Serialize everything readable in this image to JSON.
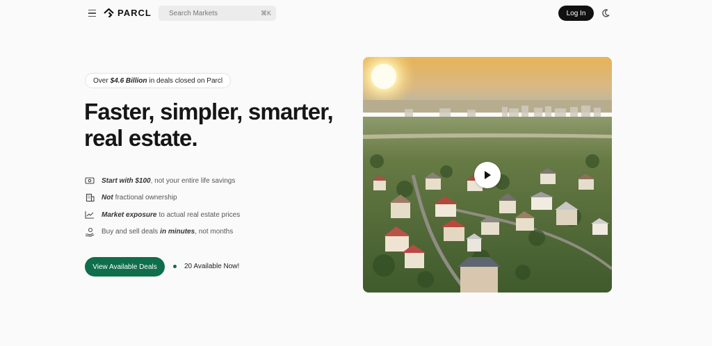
{
  "header": {
    "logo_text": "PARCL",
    "search_placeholder": "Search Markets",
    "search_shortcut": "⌘K",
    "login_label": "Log In"
  },
  "hero": {
    "badge_prefix": "Over",
    "badge_highlight": "$4.6 Billion",
    "badge_suffix": "in deals closed on Parcl",
    "headline_line1": "Faster, simpler, smarter,",
    "headline_line2": "real estate.",
    "features": [
      {
        "bold": "Start with $100",
        "text": ", not your entire life savings",
        "icon": "cash-icon"
      },
      {
        "bold": "Not",
        "text": "fractional ownership",
        "icon": "building-icon"
      },
      {
        "bold": "Market exposure",
        "text": "to actual real estate prices",
        "icon": "chart-line-icon"
      },
      {
        "pre": "Buy and sell deals",
        "bold": "in minutes",
        "text": ", not months",
        "icon": "hand-coin-icon"
      }
    ],
    "cta_label": "View Available Deals",
    "availability_text": "20 Available Now!"
  },
  "media": {
    "play_icon": "play-icon"
  },
  "colors": {
    "accent": "#0f6e4c",
    "login_bg": "#111111",
    "background": "#fafafa"
  }
}
